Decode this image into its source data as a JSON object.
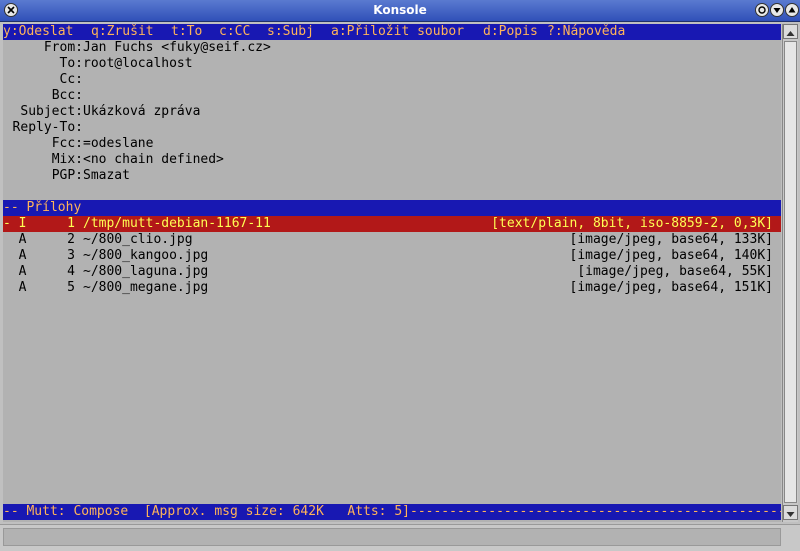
{
  "window": {
    "title": "Konsole"
  },
  "keybar": [
    {
      "key": "y",
      "label": "Odeslat",
      "col": 0
    },
    {
      "key": "q",
      "label": "Zrušit",
      "col": 11
    },
    {
      "key": "t",
      "label": "To",
      "col": 21
    },
    {
      "key": "c",
      "label": "CC",
      "col": 27
    },
    {
      "key": "s",
      "label": "Subj",
      "col": 33
    },
    {
      "key": "a",
      "label": "Přiložit soubor",
      "col": 41
    },
    {
      "key": "d",
      "label": "Popis",
      "col": 60
    },
    {
      "key": "?",
      "label": "Nápověda",
      "col": 68
    }
  ],
  "headers": [
    {
      "name": "From:",
      "value": "Jan Fuchs <fuky@seif.cz>"
    },
    {
      "name": "To:",
      "value": "root@localhost"
    },
    {
      "name": "Cc:",
      "value": ""
    },
    {
      "name": "Bcc:",
      "value": ""
    },
    {
      "name": "Subject:",
      "value": "Ukázková zpráva"
    },
    {
      "name": "Reply-To:",
      "value": ""
    },
    {
      "name": "Fcc:",
      "value": "=odeslane"
    },
    {
      "name": "Mix:",
      "value": "<no chain defined>"
    },
    {
      "name": "PGP:",
      "value": "Smazat"
    }
  ],
  "attachments_header": "-- Přílohy",
  "attachments": [
    {
      "prefix": "- I",
      "num": "1",
      "path": "/tmp/mutt-debian-1167-11",
      "info": "[text/plain, 8bit, iso-8859-2, 0,3K]",
      "selected": true
    },
    {
      "prefix": "  A",
      "num": "2",
      "path": "~/800_clio.jpg",
      "info": "[image/jpeg, base64, 133K]",
      "selected": false
    },
    {
      "prefix": "  A",
      "num": "3",
      "path": "~/800_kangoo.jpg",
      "info": "[image/jpeg, base64, 140K]",
      "selected": false
    },
    {
      "prefix": "  A",
      "num": "4",
      "path": "~/800_laguna.jpg",
      "info": "[image/jpeg, base64, 55K]",
      "selected": false
    },
    {
      "prefix": "  A",
      "num": "5",
      "path": "~/800_megane.jpg",
      "info": "[image/jpeg, base64, 151K]",
      "selected": false
    }
  ],
  "statusbar": "-- Mutt: Compose  [Approx. msg size: 642K   Atts: 5]---------------------------------------------------------"
}
